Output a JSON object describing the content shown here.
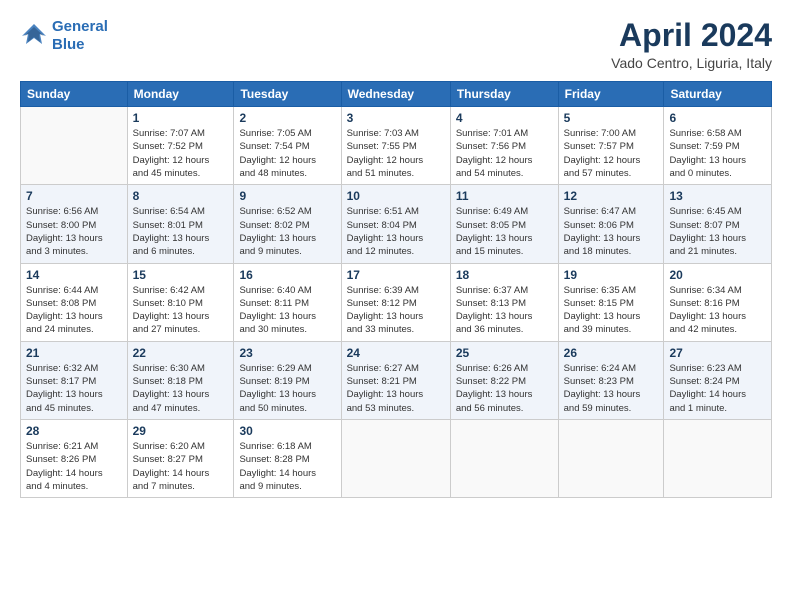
{
  "logo": {
    "line1": "General",
    "line2": "Blue"
  },
  "title": "April 2024",
  "subtitle": "Vado Centro, Liguria, Italy",
  "weekdays": [
    "Sunday",
    "Monday",
    "Tuesday",
    "Wednesday",
    "Thursday",
    "Friday",
    "Saturday"
  ],
  "weeks": [
    [
      {
        "day": "",
        "info": ""
      },
      {
        "day": "1",
        "info": "Sunrise: 7:07 AM\nSunset: 7:52 PM\nDaylight: 12 hours\nand 45 minutes."
      },
      {
        "day": "2",
        "info": "Sunrise: 7:05 AM\nSunset: 7:54 PM\nDaylight: 12 hours\nand 48 minutes."
      },
      {
        "day": "3",
        "info": "Sunrise: 7:03 AM\nSunset: 7:55 PM\nDaylight: 12 hours\nand 51 minutes."
      },
      {
        "day": "4",
        "info": "Sunrise: 7:01 AM\nSunset: 7:56 PM\nDaylight: 12 hours\nand 54 minutes."
      },
      {
        "day": "5",
        "info": "Sunrise: 7:00 AM\nSunset: 7:57 PM\nDaylight: 12 hours\nand 57 minutes."
      },
      {
        "day": "6",
        "info": "Sunrise: 6:58 AM\nSunset: 7:59 PM\nDaylight: 13 hours\nand 0 minutes."
      }
    ],
    [
      {
        "day": "7",
        "info": "Sunrise: 6:56 AM\nSunset: 8:00 PM\nDaylight: 13 hours\nand 3 minutes."
      },
      {
        "day": "8",
        "info": "Sunrise: 6:54 AM\nSunset: 8:01 PM\nDaylight: 13 hours\nand 6 minutes."
      },
      {
        "day": "9",
        "info": "Sunrise: 6:52 AM\nSunset: 8:02 PM\nDaylight: 13 hours\nand 9 minutes."
      },
      {
        "day": "10",
        "info": "Sunrise: 6:51 AM\nSunset: 8:04 PM\nDaylight: 13 hours\nand 12 minutes."
      },
      {
        "day": "11",
        "info": "Sunrise: 6:49 AM\nSunset: 8:05 PM\nDaylight: 13 hours\nand 15 minutes."
      },
      {
        "day": "12",
        "info": "Sunrise: 6:47 AM\nSunset: 8:06 PM\nDaylight: 13 hours\nand 18 minutes."
      },
      {
        "day": "13",
        "info": "Sunrise: 6:45 AM\nSunset: 8:07 PM\nDaylight: 13 hours\nand 21 minutes."
      }
    ],
    [
      {
        "day": "14",
        "info": "Sunrise: 6:44 AM\nSunset: 8:08 PM\nDaylight: 13 hours\nand 24 minutes."
      },
      {
        "day": "15",
        "info": "Sunrise: 6:42 AM\nSunset: 8:10 PM\nDaylight: 13 hours\nand 27 minutes."
      },
      {
        "day": "16",
        "info": "Sunrise: 6:40 AM\nSunset: 8:11 PM\nDaylight: 13 hours\nand 30 minutes."
      },
      {
        "day": "17",
        "info": "Sunrise: 6:39 AM\nSunset: 8:12 PM\nDaylight: 13 hours\nand 33 minutes."
      },
      {
        "day": "18",
        "info": "Sunrise: 6:37 AM\nSunset: 8:13 PM\nDaylight: 13 hours\nand 36 minutes."
      },
      {
        "day": "19",
        "info": "Sunrise: 6:35 AM\nSunset: 8:15 PM\nDaylight: 13 hours\nand 39 minutes."
      },
      {
        "day": "20",
        "info": "Sunrise: 6:34 AM\nSunset: 8:16 PM\nDaylight: 13 hours\nand 42 minutes."
      }
    ],
    [
      {
        "day": "21",
        "info": "Sunrise: 6:32 AM\nSunset: 8:17 PM\nDaylight: 13 hours\nand 45 minutes."
      },
      {
        "day": "22",
        "info": "Sunrise: 6:30 AM\nSunset: 8:18 PM\nDaylight: 13 hours\nand 47 minutes."
      },
      {
        "day": "23",
        "info": "Sunrise: 6:29 AM\nSunset: 8:19 PM\nDaylight: 13 hours\nand 50 minutes."
      },
      {
        "day": "24",
        "info": "Sunrise: 6:27 AM\nSunset: 8:21 PM\nDaylight: 13 hours\nand 53 minutes."
      },
      {
        "day": "25",
        "info": "Sunrise: 6:26 AM\nSunset: 8:22 PM\nDaylight: 13 hours\nand 56 minutes."
      },
      {
        "day": "26",
        "info": "Sunrise: 6:24 AM\nSunset: 8:23 PM\nDaylight: 13 hours\nand 59 minutes."
      },
      {
        "day": "27",
        "info": "Sunrise: 6:23 AM\nSunset: 8:24 PM\nDaylight: 14 hours\nand 1 minute."
      }
    ],
    [
      {
        "day": "28",
        "info": "Sunrise: 6:21 AM\nSunset: 8:26 PM\nDaylight: 14 hours\nand 4 minutes."
      },
      {
        "day": "29",
        "info": "Sunrise: 6:20 AM\nSunset: 8:27 PM\nDaylight: 14 hours\nand 7 minutes."
      },
      {
        "day": "30",
        "info": "Sunrise: 6:18 AM\nSunset: 8:28 PM\nDaylight: 14 hours\nand 9 minutes."
      },
      {
        "day": "",
        "info": ""
      },
      {
        "day": "",
        "info": ""
      },
      {
        "day": "",
        "info": ""
      },
      {
        "day": "",
        "info": ""
      }
    ]
  ]
}
